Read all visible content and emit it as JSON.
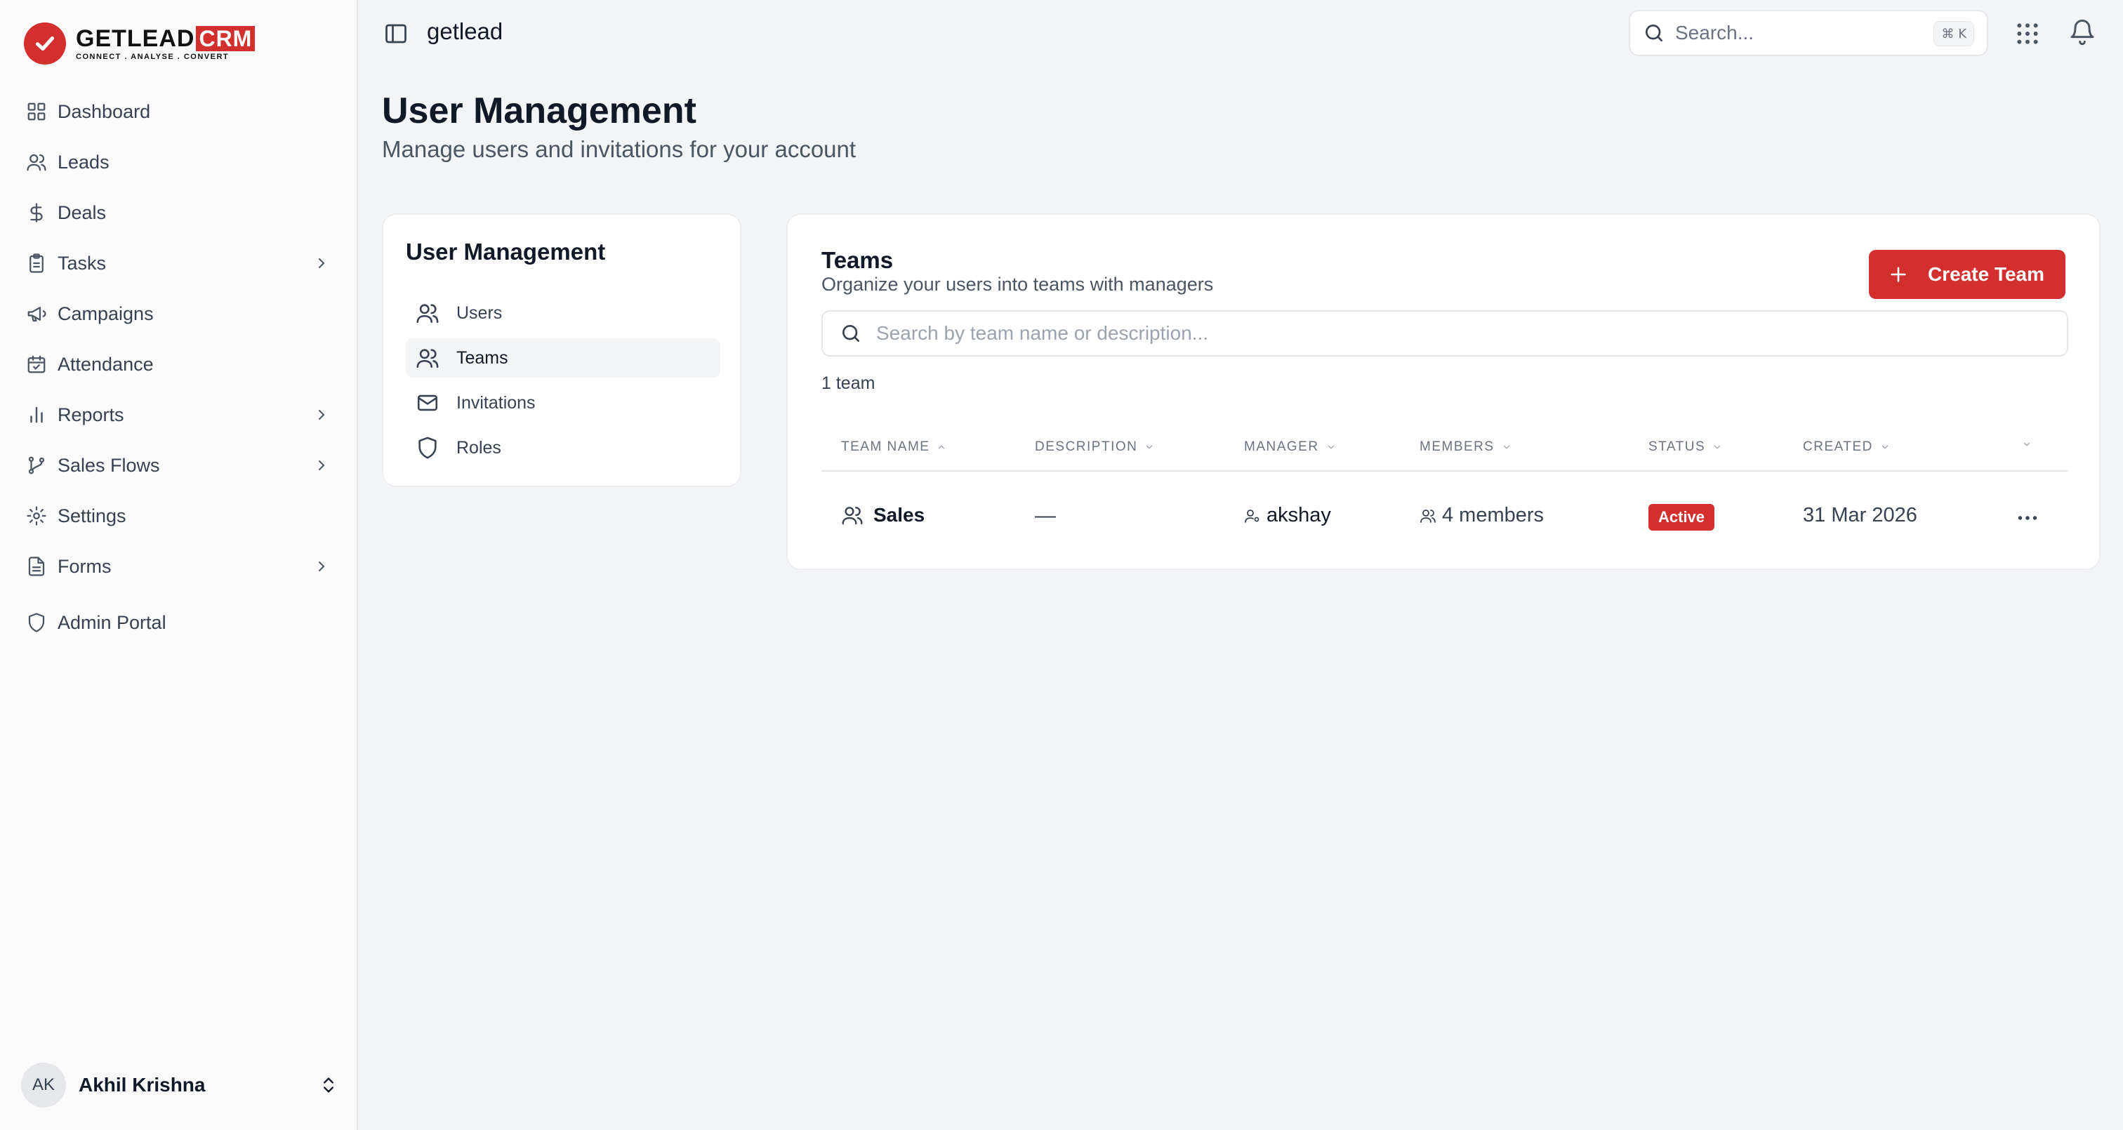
{
  "brand": {
    "name": "GETLEAD",
    "suffix": "CRM",
    "tagline": "CONNECT . ANALYSE . CONVERT",
    "accent": "#d32f2f"
  },
  "sidebar": {
    "items": [
      {
        "label": "Dashboard",
        "icon": "grid-icon",
        "chevron": false
      },
      {
        "label": "Leads",
        "icon": "users-icon",
        "chevron": false
      },
      {
        "label": "Deals",
        "icon": "dollar-icon",
        "chevron": false
      },
      {
        "label": "Tasks",
        "icon": "clipboard-icon",
        "chevron": true
      },
      {
        "label": "Campaigns",
        "icon": "megaphone-icon",
        "chevron": false
      },
      {
        "label": "Attendance",
        "icon": "calendar-check-icon",
        "chevron": false
      },
      {
        "label": "Reports",
        "icon": "bar-chart-icon",
        "chevron": true
      },
      {
        "label": "Sales Flows",
        "icon": "git-branch-icon",
        "chevron": true
      },
      {
        "label": "Settings",
        "icon": "gear-icon",
        "chevron": false
      },
      {
        "label": "Forms",
        "icon": "file-text-icon",
        "chevron": true
      },
      {
        "label": "Admin Portal",
        "icon": "shield-icon",
        "chevron": false
      }
    ],
    "user": {
      "initials": "AK",
      "name": "Akhil Krishna"
    }
  },
  "topbar": {
    "workspace": "getlead",
    "search_placeholder": "Search...",
    "search_shortcut": "⌘ K"
  },
  "page": {
    "title": "User Management",
    "subtitle": "Manage users and invitations for your account"
  },
  "um_nav": {
    "title": "User Management",
    "items": [
      {
        "label": "Users",
        "active": false
      },
      {
        "label": "Teams",
        "active": true
      },
      {
        "label": "Invitations",
        "active": false
      },
      {
        "label": "Roles",
        "active": false
      }
    ]
  },
  "teams": {
    "title": "Teams",
    "subtitle": "Organize your users into teams with managers",
    "create_label": "Create Team",
    "search_placeholder": "Search by team name or description...",
    "count_text": "1 team",
    "columns": [
      "TEAM NAME",
      "DESCRIPTION",
      "MANAGER",
      "MEMBERS",
      "STATUS",
      "CREATED"
    ],
    "rows": [
      {
        "name": "Sales",
        "description": "—",
        "manager": "akshay",
        "members": "4 members",
        "status": "Active",
        "created": "31 Mar 2026"
      }
    ]
  }
}
